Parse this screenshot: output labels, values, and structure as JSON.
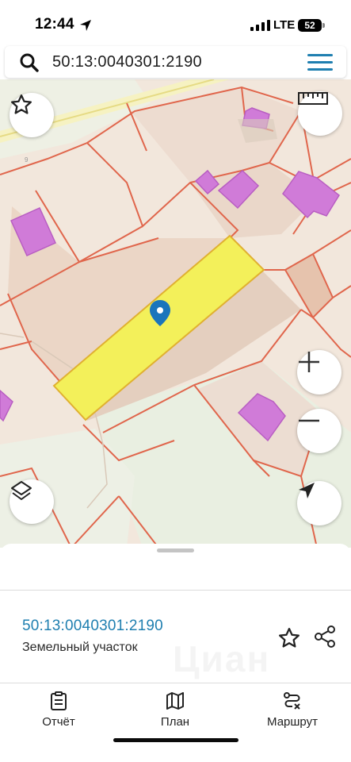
{
  "status_bar": {
    "time": "12:44",
    "network": "LTE",
    "battery": "52"
  },
  "search": {
    "query": "50:13:0040301:2190",
    "icon": "search-icon",
    "menu_icon": "hamburger-menu-icon"
  },
  "map": {
    "selected_parcel_color": "#f3f05a",
    "boundary_color": "#e0664c",
    "building_color": "#d17ad8",
    "marker_color": "#1b75bc",
    "controls": {
      "favorite": "star-icon",
      "ruler": "ruler-icon",
      "zoom_in": "plus-icon",
      "zoom_out": "minus-icon",
      "layers": "layers-icon",
      "locate": "navigation-arrow-icon"
    }
  },
  "sheet": {
    "parcel_number": "50:13:0040301:2190",
    "parcel_type": "Земельный участок",
    "watermark": "Циан",
    "accent_color": "#1f7fb0"
  },
  "tabs": [
    {
      "label": "Отчёт",
      "icon": "report-clipboard-icon"
    },
    {
      "label": "План",
      "icon": "map-plan-icon"
    },
    {
      "label": "Маршрут",
      "icon": "route-icon"
    }
  ]
}
